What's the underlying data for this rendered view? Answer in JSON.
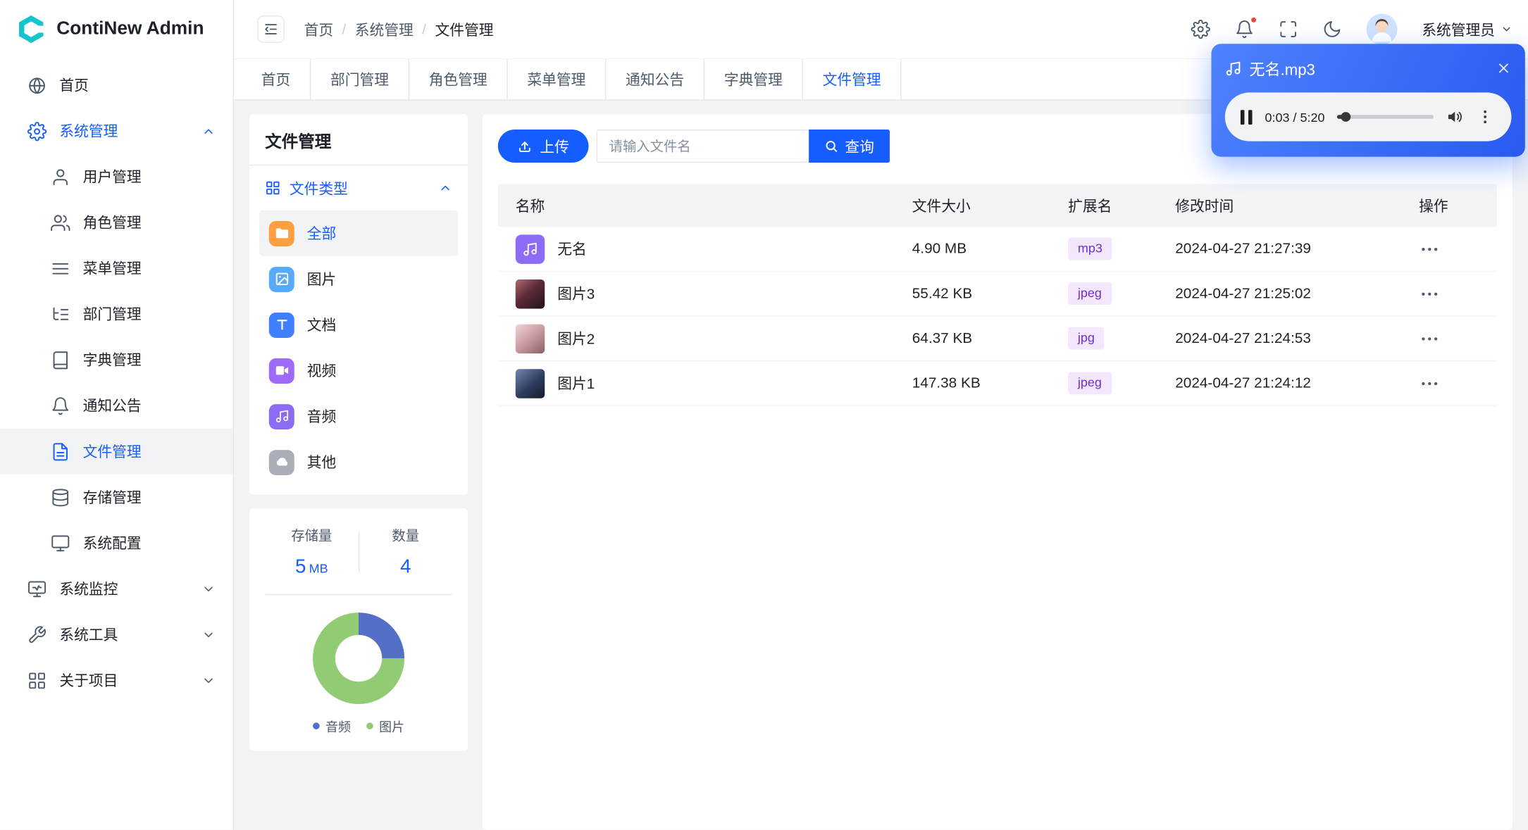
{
  "app": {
    "title": "ContiNew Admin"
  },
  "header": {
    "breadcrumb": [
      "首页",
      "系统管理",
      "文件管理"
    ],
    "separator": "/",
    "user_name": "系统管理员"
  },
  "tabs": [
    "首页",
    "部门管理",
    "角色管理",
    "菜单管理",
    "通知公告",
    "字典管理",
    "文件管理"
  ],
  "active_tab": "文件管理",
  "sidebar": {
    "items": [
      {
        "label": "首页"
      },
      {
        "label": "系统管理",
        "expanded": true,
        "children": [
          "用户管理",
          "角色管理",
          "菜单管理",
          "部门管理",
          "字典管理",
          "通知公告",
          "文件管理",
          "存储管理",
          "系统配置"
        ]
      },
      {
        "label": "系统监控"
      },
      {
        "label": "系统工具"
      },
      {
        "label": "关于项目"
      }
    ],
    "active_item": "文件管理"
  },
  "file_panel": {
    "title": "文件管理",
    "group_label": "文件类型",
    "types": [
      "全部",
      "图片",
      "文档",
      "视频",
      "音频",
      "其他"
    ],
    "active_type": "全部",
    "stats": {
      "storage_label": "存储量",
      "storage_value": "5",
      "storage_unit": "MB",
      "count_label": "数量",
      "count_value": "4"
    }
  },
  "chart_data": {
    "type": "pie",
    "categories": [
      "音频",
      "图片"
    ],
    "values": [
      1,
      3
    ],
    "colors": [
      "#5470c6",
      "#91cc75"
    ],
    "legend_position": "bottom"
  },
  "toolbar": {
    "upload_label": "上传",
    "search_placeholder": "请输入文件名",
    "search_label": "查询"
  },
  "table": {
    "columns": [
      "名称",
      "文件大小",
      "扩展名",
      "修改时间",
      "操作"
    ],
    "rows": [
      {
        "name": "无名",
        "size": "4.90 MB",
        "ext": "mp3",
        "time": "2024-04-27 21:27:39",
        "type": "audio"
      },
      {
        "name": "图片3",
        "size": "55.42 KB",
        "ext": "jpeg",
        "time": "2024-04-27 21:25:02",
        "type": "image"
      },
      {
        "name": "图片2",
        "size": "64.37 KB",
        "ext": "jpg",
        "time": "2024-04-27 21:24:53",
        "type": "image"
      },
      {
        "name": "图片1",
        "size": "147.38 KB",
        "ext": "jpeg",
        "time": "2024-04-27 21:24:12",
        "type": "image"
      }
    ]
  },
  "player": {
    "title": "无名.mp3",
    "time": "0:03 / 5:20"
  },
  "colors": {
    "primary": "#165dff",
    "badge_bg": "#f3e7fe",
    "badge_text": "#722ed1",
    "danger": "#f53f3f"
  }
}
